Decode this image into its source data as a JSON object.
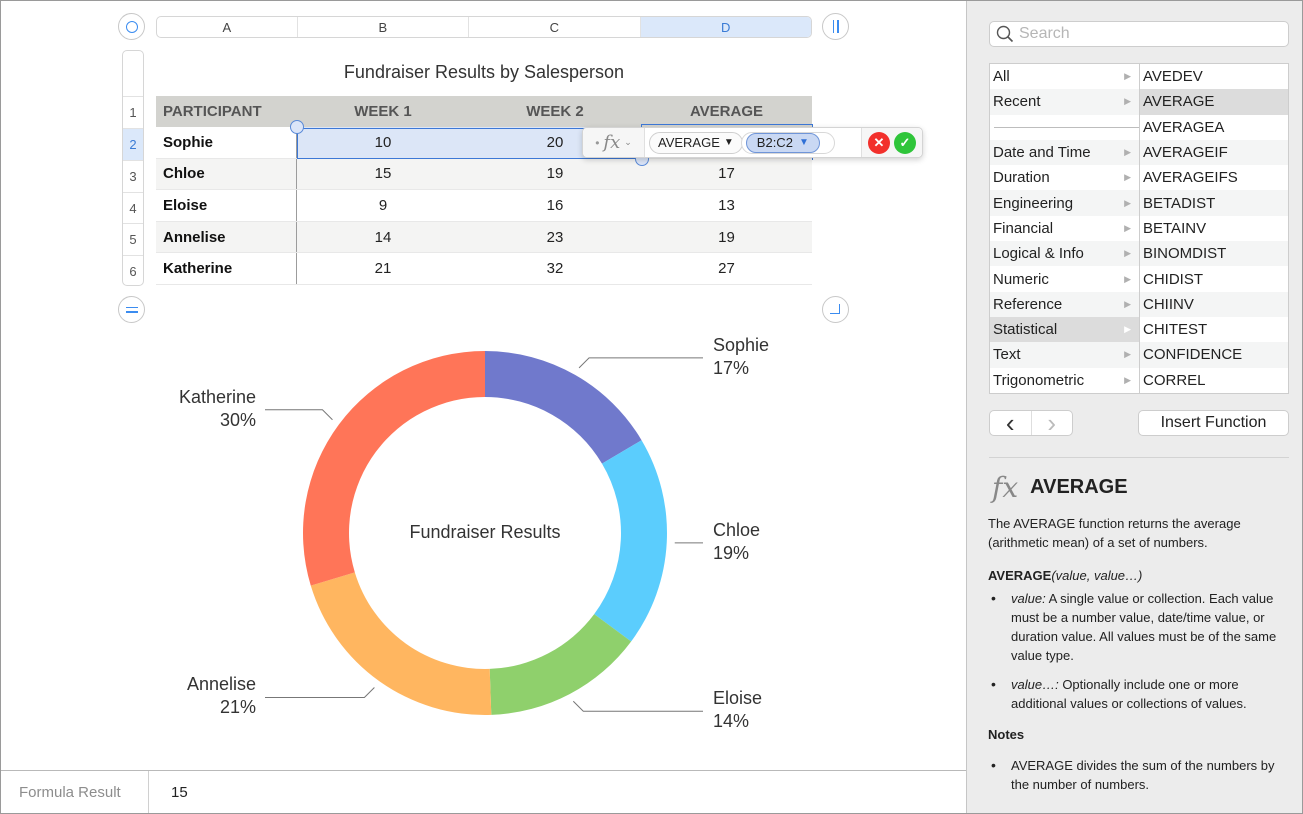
{
  "sheet": {
    "columns": [
      "A",
      "B",
      "C",
      "D"
    ],
    "selected_column": "D",
    "rows": [
      "1",
      "2",
      "3",
      "4",
      "5",
      "6"
    ],
    "selected_row": "2",
    "table_title": "Fundraiser Results by Salesperson",
    "headers": [
      "PARTICIPANT",
      "WEEK 1",
      "WEEK 2",
      "AVERAGE"
    ],
    "data": [
      {
        "name": "Sophie",
        "week1": "10",
        "week2": "20",
        "average": ""
      },
      {
        "name": "Chloe",
        "week1": "15",
        "week2": "19",
        "average": "17"
      },
      {
        "name": "Eloise",
        "week1": "9",
        "week2": "16",
        "average": "13"
      },
      {
        "name": "Annelise",
        "week1": "14",
        "week2": "23",
        "average": "19"
      },
      {
        "name": "Katherine",
        "week1": "21",
        "week2": "32",
        "average": "27"
      }
    ]
  },
  "formula": {
    "fx_label": "fx",
    "function": "AVERAGE",
    "reference": "B2:C2",
    "cancel_icon": "✕",
    "accept_icon": "✓"
  },
  "chart_data": {
    "type": "pie",
    "variant": "donut",
    "title": "Fundraiser Results",
    "categories": [
      "Sophie",
      "Chloe",
      "Eloise",
      "Annelise",
      "Katherine"
    ],
    "values": [
      15,
      17,
      13,
      19,
      27
    ],
    "labels": [
      "17%",
      "19%",
      "14%",
      "21%",
      "30%"
    ],
    "colors": [
      "#7079cc",
      "#5bcdfd",
      "#8fd06c",
      "#ffb660",
      "#ff7558"
    ],
    "start": "top",
    "direction": "clockwise"
  },
  "status": {
    "label": "Formula Result",
    "value": "15"
  },
  "sidebar": {
    "search_placeholder": "Search",
    "categories": [
      {
        "label": "All",
        "selected": false
      },
      {
        "label": "Recent",
        "selected": false
      },
      {
        "label": "",
        "separator": true
      },
      {
        "label": "Date and Time",
        "selected": false
      },
      {
        "label": "Duration",
        "selected": false
      },
      {
        "label": "Engineering",
        "selected": false
      },
      {
        "label": "Financial",
        "selected": false
      },
      {
        "label": "Logical & Info",
        "selected": false
      },
      {
        "label": "Numeric",
        "selected": false
      },
      {
        "label": "Reference",
        "selected": false
      },
      {
        "label": "Statistical",
        "selected": true
      },
      {
        "label": "Text",
        "selected": false
      },
      {
        "label": "Trigonometric",
        "selected": false
      }
    ],
    "functions": [
      {
        "label": "AVEDEV",
        "selected": false
      },
      {
        "label": "AVERAGE",
        "selected": true
      },
      {
        "label": "AVERAGEA",
        "selected": false
      },
      {
        "label": "AVERAGEIF",
        "selected": false
      },
      {
        "label": "AVERAGEIFS",
        "selected": false
      },
      {
        "label": "BETADIST",
        "selected": false
      },
      {
        "label": "BETAINV",
        "selected": false
      },
      {
        "label": "BINOMDIST",
        "selected": false
      },
      {
        "label": "CHIDIST",
        "selected": false
      },
      {
        "label": "CHIINV",
        "selected": false
      },
      {
        "label": "CHITEST",
        "selected": false
      },
      {
        "label": "CONFIDENCE",
        "selected": false
      },
      {
        "label": "CORREL",
        "selected": false
      }
    ],
    "back_icon": "‹",
    "forward_icon": "›",
    "insert_button": "Insert Function",
    "help": {
      "fx": "fx",
      "name": "AVERAGE",
      "description": "The AVERAGE function returns the average (arithmetic mean) of a set of numbers.",
      "syntax_name": "AVERAGE",
      "syntax_args": "(value, value…)",
      "args": [
        {
          "name": "value:",
          "text": " A single value or collection. Each value must be a number value, date/time value, or duration value. All values must be of the same value type."
        },
        {
          "name": "value…:",
          "text": " Optionally include one or more additional values or collections of values."
        }
      ],
      "notes_heading": "Notes",
      "notes": [
        "AVERAGE divides the sum of the numbers by the number of numbers."
      ]
    }
  }
}
